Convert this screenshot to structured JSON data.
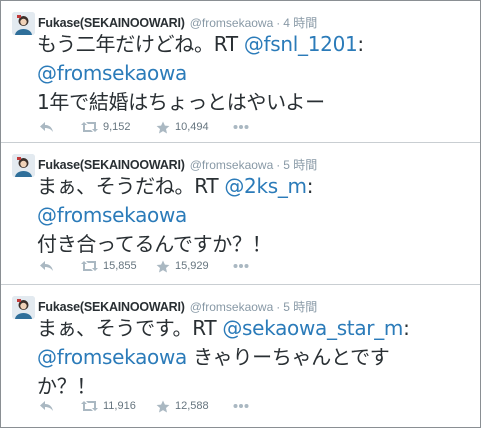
{
  "tweets": [
    {
      "name": "Fukase(SEKAINOOWARI)",
      "handle": "@fromsekaowa",
      "separator": "·",
      "time": "4 時間",
      "lines": [
        [
          {
            "t": "もう二年だけどね。RT ",
            "m": false
          },
          {
            "t": "@fsnl_1201",
            "m": true
          },
          {
            "t": ":",
            "m": false
          }
        ],
        [
          {
            "t": "@fromsekaowa",
            "m": true
          }
        ],
        [
          {
            "t": "1年で結婚はちょっとはやいよー",
            "m": false
          }
        ]
      ],
      "retweets": "9,152",
      "favorites": "10,494"
    },
    {
      "name": "Fukase(SEKAINOOWARI)",
      "handle": "@fromsekaowa",
      "separator": "·",
      "time": "5 時間",
      "lines": [
        [
          {
            "t": "まぁ、そうだね。RT ",
            "m": false
          },
          {
            "t": "@2ks_m",
            "m": true
          },
          {
            "t": ":",
            "m": false
          }
        ],
        [
          {
            "t": "@fromsekaowa",
            "m": true
          }
        ],
        [
          {
            "t": "付き合ってるんですか？！",
            "m": false
          }
        ]
      ],
      "retweets": "15,855",
      "favorites": "15,929"
    },
    {
      "name": "Fukase(SEKAINOOWARI)",
      "handle": "@fromsekaowa",
      "separator": "·",
      "time": "5 時間",
      "lines": [
        [
          {
            "t": "まぁ、そうです。RT ",
            "m": false
          },
          {
            "t": "@sekaowa_star_m",
            "m": true
          },
          {
            "t": ":",
            "m": false
          }
        ],
        [
          {
            "t": "@fromsekaowa",
            "m": true
          },
          {
            "t": " きゃりーちゃんとです",
            "m": false
          }
        ],
        [
          {
            "t": "か？！",
            "m": false
          }
        ]
      ],
      "retweets": "11,916",
      "favorites": "12,588"
    }
  ],
  "icons": {
    "reply": "reply-icon",
    "retweet": "retweet-icon",
    "favorite": "star-icon",
    "more": "more-icon"
  },
  "colors": {
    "mention": "#2b7bb9",
    "meta": "#8899a6",
    "action": "#aab8c2",
    "text": "#292f33"
  }
}
